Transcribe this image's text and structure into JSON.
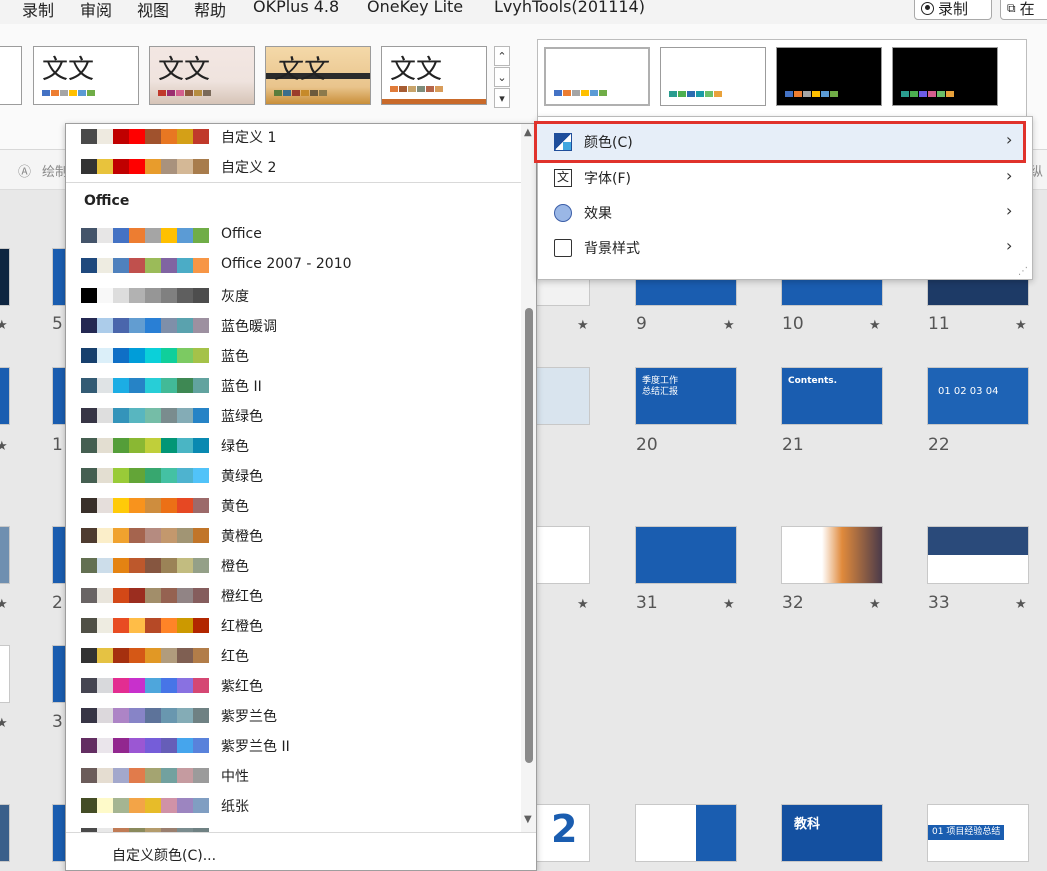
{
  "tabs": [
    "录制",
    "审阅",
    "视图",
    "帮助",
    "OKPlus 4.8",
    "OneKey Lite",
    "LvyhTools(201114)"
  ],
  "record_button": "录制",
  "right_partial_button": "在",
  "theme_glyph": "文文",
  "toolstrip": {
    "left_label": "绘制",
    "right_label": "纵"
  },
  "slides": {
    "row1": [
      {
        "num": "9"
      },
      {
        "num": "10"
      },
      {
        "num": "11"
      }
    ],
    "row2": [
      {
        "num": "20",
        "title": "季度工作\n总结汇报"
      },
      {
        "num": "21",
        "title": "Contents."
      },
      {
        "num": "22",
        "title": "01 02 03 04"
      }
    ],
    "row3": [
      {
        "num": "31"
      },
      {
        "num": "32"
      },
      {
        "num": "33"
      }
    ],
    "row4": [
      {
        "title": "2"
      },
      {
        "title": "教科"
      },
      {
        "title": "01 项目经验总结"
      }
    ],
    "left_nums": [
      "5",
      "1",
      "2",
      "3"
    ],
    "star": "★"
  },
  "color_list": {
    "custom": [
      {
        "label": "自定义 1",
        "colors": [
          "#4a4a4a",
          "#eeeae0",
          "#c00000",
          "#ff0000",
          "#a0522d",
          "#e87722",
          "#d4a017",
          "#c0392b"
        ]
      },
      {
        "label": "自定义 2",
        "colors": [
          "#333333",
          "#e8c33c",
          "#c00000",
          "#ff0000",
          "#e89c2c",
          "#a9927d",
          "#d4b896",
          "#a87c4c"
        ]
      }
    ],
    "office_heading": "Office",
    "office": [
      {
        "label": "Office",
        "colors": [
          "#44546a",
          "#e7e6e6",
          "#4472c4",
          "#ed7d31",
          "#a5a5a5",
          "#ffc000",
          "#5b9bd5",
          "#70ad47"
        ]
      },
      {
        "label": "Office 2007 - 2010",
        "colors": [
          "#1f497d",
          "#eeece1",
          "#4f81bd",
          "#c0504d",
          "#9bbb59",
          "#8064a2",
          "#4bacc6",
          "#f79646"
        ]
      },
      {
        "label": "灰度",
        "colors": [
          "#000000",
          "#f8f8f8",
          "#dddddd",
          "#b2b2b2",
          "#969696",
          "#808080",
          "#5f5f5f",
          "#4d4d4d"
        ]
      },
      {
        "label": "蓝色暖调",
        "colors": [
          "#242852",
          "#acccea",
          "#4a66ac",
          "#629dd1",
          "#297fd5",
          "#7f8fa9",
          "#5aa2ae",
          "#9d90a0"
        ]
      },
      {
        "label": "蓝色",
        "colors": [
          "#17406d",
          "#dbeff9",
          "#0f6fc6",
          "#009dd9",
          "#0bd0d9",
          "#10cf9b",
          "#7cca62",
          "#a5c249"
        ]
      },
      {
        "label": "蓝色 II",
        "colors": [
          "#335b74",
          "#dfe3e5",
          "#1cade4",
          "#2683c6",
          "#27ced7",
          "#42ba97",
          "#3e8853",
          "#62a39f"
        ]
      },
      {
        "label": "蓝绿色",
        "colors": [
          "#373545",
          "#dedede",
          "#3494ba",
          "#58b6c0",
          "#75bda7",
          "#7a8c8e",
          "#84acb6",
          "#2683c6"
        ]
      },
      {
        "label": "绿色",
        "colors": [
          "#455f51",
          "#e3ded1",
          "#549e39",
          "#8ab833",
          "#c0cf3a",
          "#029676",
          "#4ab5c4",
          "#0989b1"
        ]
      },
      {
        "label": "黄绿色",
        "colors": [
          "#455f51",
          "#e3ded1",
          "#99cb38",
          "#63a537",
          "#37a76f",
          "#44c1a3",
          "#4eb3cf",
          "#51c3f9"
        ]
      },
      {
        "label": "黄色",
        "colors": [
          "#39302a",
          "#e5dedb",
          "#ffca08",
          "#f8931d",
          "#ce8d3e",
          "#ec7016",
          "#e64823",
          "#9c6a6a"
        ]
      },
      {
        "label": "黄橙色",
        "colors": [
          "#4e3b30",
          "#fbeec9",
          "#f0a22e",
          "#a5644e",
          "#b58b80",
          "#c3986d",
          "#a19574",
          "#c17529"
        ]
      },
      {
        "label": "橙色",
        "colors": [
          "#637052",
          "#ccddea",
          "#e48312",
          "#bd582c",
          "#865640",
          "#9b8357",
          "#c2bc80",
          "#94a088"
        ]
      },
      {
        "label": "橙红色",
        "colors": [
          "#696464",
          "#e9e5dc",
          "#d34817",
          "#9b2d1f",
          "#a28e6a",
          "#956251",
          "#918485",
          "#855d5d"
        ]
      },
      {
        "label": "红橙色",
        "colors": [
          "#505046",
          "#eeece1",
          "#e84c22",
          "#ffbd47",
          "#b64926",
          "#ff8427",
          "#cc9900",
          "#b22600"
        ]
      },
      {
        "label": "红色",
        "colors": [
          "#323232",
          "#e5c243",
          "#a5300f",
          "#d55816",
          "#e19825",
          "#b19c7d",
          "#7f5f52",
          "#b27d49"
        ]
      },
      {
        "label": "紫红色",
        "colors": [
          "#454551",
          "#d8d9dc",
          "#e32d91",
          "#c830cc",
          "#4ea6dc",
          "#4775e7",
          "#8971e1",
          "#d54773"
        ]
      },
      {
        "label": "紫罗兰色",
        "colors": [
          "#373545",
          "#dcd8dc",
          "#ad84c6",
          "#8784c7",
          "#5d739a",
          "#6997af",
          "#84acb6",
          "#6f8183"
        ]
      },
      {
        "label": "紫罗兰色 II",
        "colors": [
          "#632e62",
          "#eae5eb",
          "#92278f",
          "#9b57d3",
          "#755dd9",
          "#665eb8",
          "#45a5ed",
          "#5982db"
        ]
      },
      {
        "label": "中性",
        "colors": [
          "#6b5c5a",
          "#e5ddd1",
          "#a3a8cc",
          "#e17b4b",
          "#a4a471",
          "#72a19f",
          "#c59ba0",
          "#9b9b9b"
        ]
      },
      {
        "label": "纸张",
        "colors": [
          "#444d26",
          "#fefac9",
          "#a5b592",
          "#f3a447",
          "#e7bc29",
          "#d092a7",
          "#9c85c0",
          "#809ec2"
        ]
      },
      {
        "label": "",
        "colors": [
          "#4a4a4a",
          "#e8e8e8",
          "#c07b55",
          "#8a8a5c",
          "#b49c6c",
          "#9a7f6f",
          "#7a8c8e",
          "#6f8183"
        ]
      }
    ],
    "custom_color_action": "自定义颜色(C)..."
  },
  "submenu": [
    {
      "label": "颜色(C)",
      "selected": true
    },
    {
      "label": "字体(F)"
    },
    {
      "label": "效果"
    },
    {
      "label": "背景样式"
    }
  ],
  "font_icon_glyph": "文",
  "accent_highlight": "#e0322b"
}
